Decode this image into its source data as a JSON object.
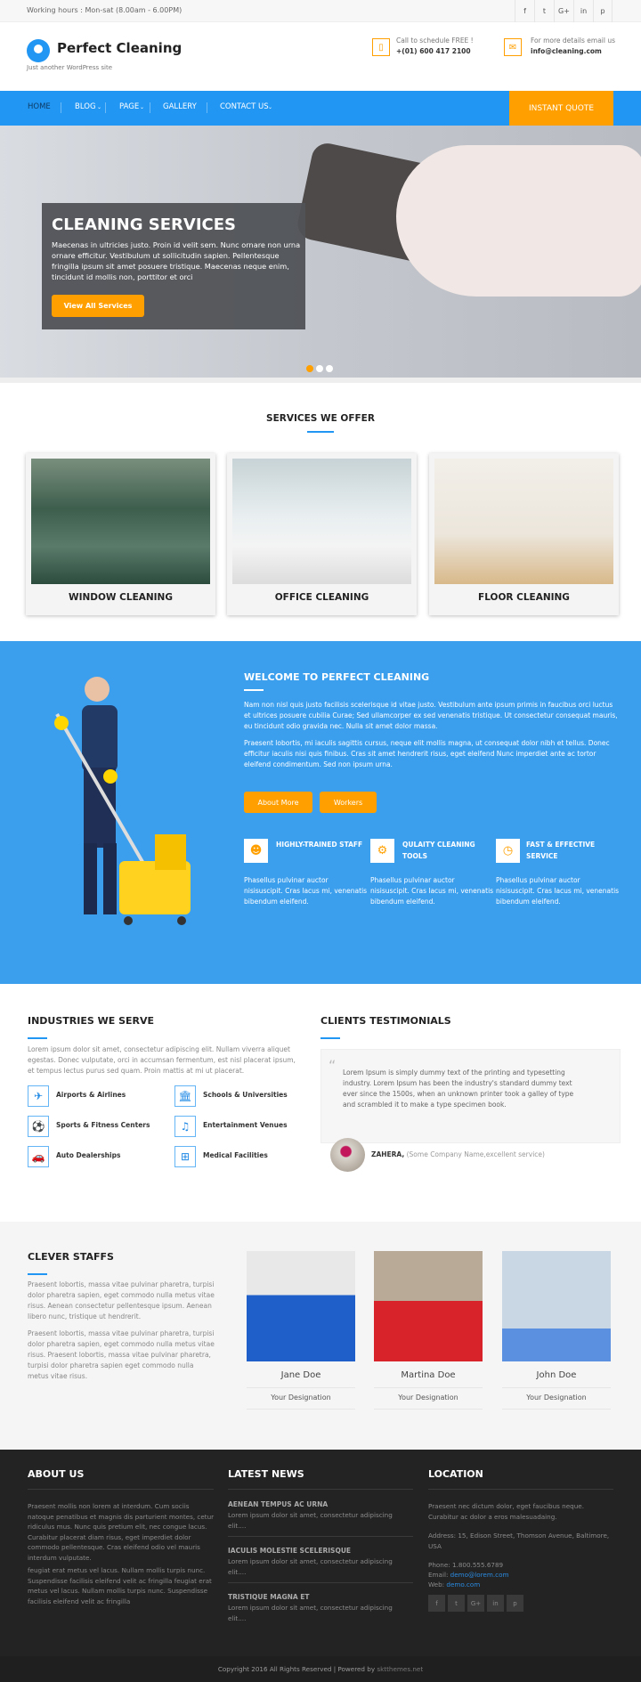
{
  "topbar": {
    "hours": "Working hours : Mon-sat (8.00am - 6.00PM)",
    "social": [
      "f",
      "t",
      "G+",
      "in",
      "p"
    ]
  },
  "header": {
    "brand": "Perfect Cleaning",
    "tagline": "Just another WordPress site",
    "call_label": "Call to schedule FREE !",
    "phone": "+(01) 600 417 2100",
    "email_label": "For more details email us",
    "email": "info@cleaning.com"
  },
  "nav": {
    "items": [
      "HOME",
      "BLOG",
      "PAGE",
      "GALLERY",
      "CONTACT US"
    ],
    "quote": "INSTANT QUOTE"
  },
  "hero": {
    "title": "CLEANING SERVICES",
    "text": "Maecenas in ultricies justo. Proin id velit sem. Nunc ornare non urna ornare efficitur. Vestibulum ut sollicitudin sapien. Pellentesque fringilla ipsum sit amet posuere tristique. Maecenas neque enim, tincidunt id mollis non, porttitor et orci",
    "button": "View All Services",
    "slides": 3,
    "active_slide": 1
  },
  "services": {
    "title": "SERVICES WE OFFER",
    "items": [
      "WINDOW CLEANING",
      "OFFICE CLEANING",
      "FLOOR CLEANING"
    ]
  },
  "welcome": {
    "title": "WELCOME TO PERFECT CLEANING",
    "p1": "Nam non nisl quis justo facilisis scelerisque id vitae justo. Vestibulum ante ipsum primis in faucibus orci luctus et ultrices posuere cubilia Curae; Sed ullamcorper ex sed venenatis tristique. Ut consectetur consequat mauris, eu tincidunt odio gravida nec. Nulla sit amet dolor massa.",
    "p2": "Praesent lobortis, mi iaculis sagittis cursus, neque elit mollis magna, ut consequat dolor nibh et tellus. Donec efficitur iaculis nisi quis finibus. Cras sit amet hendrerit risus, eget eleifend Nunc imperdiet ante ac tortor eleifend condimentum. Sed non ipsum urna.",
    "btn1": "About More",
    "btn2": "Workers",
    "features": [
      {
        "title": "HIGHLY-TRAINED STAFF",
        "icon": "users-icon",
        "text": "Phasellus pulvinar auctor nisisuscipit. Cras lacus mi, venenatis bibendum eleifend."
      },
      {
        "title": "QULAITY CLEANING TOOLS",
        "icon": "gears-icon",
        "text": "Phasellus pulvinar auctor nisisuscipit. Cras lacus mi, venenatis bibendum eleifend."
      },
      {
        "title": "FAST & EFFECTIVE SERVICE",
        "icon": "clock-icon",
        "text": "Phasellus pulvinar auctor nisisuscipit. Cras lacus mi, venenatis bibendum eleifend."
      }
    ]
  },
  "industries": {
    "title": "INDUSTRIES WE SERVE",
    "text": "Lorem ipsum dolor sit amet, consectetur adipiscing elit. Nullam viverra aliquet egestas. Donec vulputate, orci in accumsan fermentum, est nisl placerat ipsum, et tempus lectus purus sed quam. Proin mattis at mi ut placerat.",
    "items": [
      {
        "label": "Airports & Airlines",
        "icon": "plane-icon"
      },
      {
        "label": "Schools & Universities",
        "icon": "bank-icon"
      },
      {
        "label": "Sports & Fitness Centers",
        "icon": "soccer-icon"
      },
      {
        "label": "Entertainment Venues",
        "icon": "music-icon"
      },
      {
        "label": "Auto Dealerships",
        "icon": "car-icon"
      },
      {
        "label": "Medical Facilities",
        "icon": "medical-icon"
      }
    ]
  },
  "testimonials": {
    "title": "CLIENTS TESTIMONIALS",
    "quote": "Lorem Ipsum is simply dummy text of the printing and typesetting industry. Lorem Ipsum has been the industry's standard dummy text ever since the 1500s, when an unknown printer took a galley of type and scrambled it to make a type specimen book.",
    "name": "ZAHERA,",
    "company": "(Some Company Name,excellent service)"
  },
  "staffs": {
    "title": "CLEVER STAFFS",
    "p1": "Praesent lobortis, massa vitae pulvinar pharetra, turpisi dolor pharetra sapien, eget commodo nulla metus vitae risus. Aenean consectetur pellentesque ipsum. Aenean libero nunc, tristique ut hendrerit.",
    "p2": "Praesent lobortis, massa vitae pulvinar pharetra, turpisi dolor pharetra sapien, eget commodo nulla metus vitae risus. Praesent lobortis, massa vitae pulvinar pharetra, turpisi dolor pharetra sapien eget commodo nulla metus vitae risus.",
    "members": [
      {
        "name": "Jane Doe",
        "designation": "Your Designation"
      },
      {
        "name": "Martina Doe",
        "designation": "Your Designation"
      },
      {
        "name": "John Doe",
        "designation": "Your Designation"
      }
    ]
  },
  "footer": {
    "about_title": "ABOUT US",
    "about_p1": "Praesent mollis non lorem at interdum. Cum sociis natoque penatibus et magnis dis parturient montes, cetur ridiculus mus. Nunc quis pretium elit, nec congue lacus. Curabitur placerat diam risus, eget imperdiet dolor commodo pellentesque. Cras eleifend odio vel mauris interdum vulputate.",
    "about_p2": "feugiat erat metus vel lacus. Nullam mollis turpis nunc. Suspendisse facilisis eleifend velit ac fringilla feugiat erat metus vel lacus. Nullam mollis turpis nunc. Suspendisse facilisis eleifend velit ac fringilla",
    "news_title": "LATEST NEWS",
    "news": [
      {
        "title": "AENEAN TEMPUS AC URNA",
        "text": "Lorem ipsum dolor sit amet, consectetur adipiscing elit...."
      },
      {
        "title": "IACULIS MOLESTIE SCELERISQUE",
        "text": "Lorem ipsum dolor sit amet, consectetur adipiscing elit...."
      },
      {
        "title": "TRISTIQUE MAGNA ET",
        "text": "Lorem ipsum dolor sit amet, consectetur adipiscing elit...."
      }
    ],
    "loc_title": "LOCATION",
    "loc_text": "Praesent nec dictum dolor, eget faucibus neque. Curabitur ac dolor a eros malesuadaing.",
    "address": "Address: 15, Edison Street, Thomson Avenue, Baltimore, USA",
    "phone": "Phone: 1.800.555.6789",
    "email_label": "Email:",
    "email": "demo@lorem.com",
    "web_label": "Web:",
    "web": "demo.com",
    "social": [
      "f",
      "t",
      "G+",
      "in",
      "p"
    ]
  },
  "copyright": {
    "text": "Copyright 2016 All Rights Reserved | Powered by ",
    "link": "sktthemes.net"
  },
  "colors": {
    "primary": "#2196f3",
    "accent": "#ffa000",
    "footer": "#232323"
  }
}
